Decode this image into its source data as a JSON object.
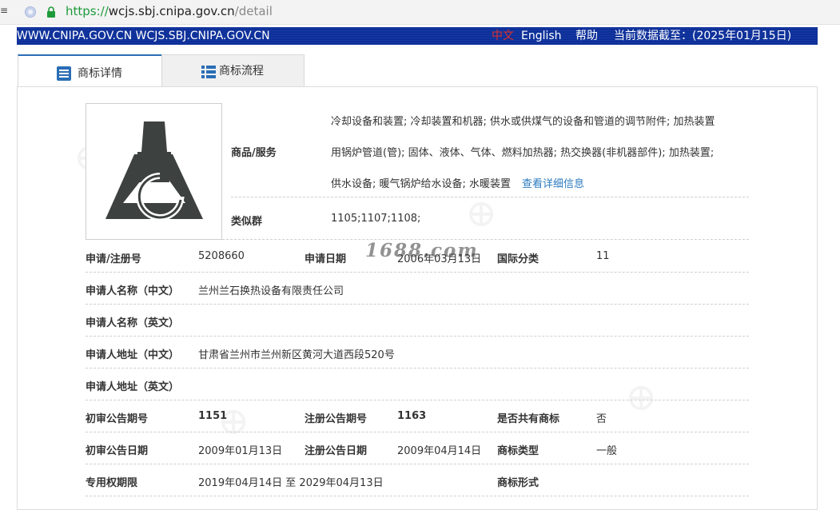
{
  "browser": {
    "url_scheme": "https://",
    "url_host": "wcjs.sbj.cnipa.gov.cn",
    "url_path": "/detail"
  },
  "site_header": {
    "domains": "WWW.CNIPA.GOV.CN  WCJS.SBJ.CNIPA.GOV.CN",
    "lang_zh": "中文",
    "lang_en": "English",
    "help": "帮助",
    "data_date": "当前数据截至：(2025年01月15日)"
  },
  "tabs": [
    {
      "label": "商标详情"
    },
    {
      "label": "商标流程"
    }
  ],
  "watermark_text": "1688.com",
  "detail": {
    "goods_label": "商品/服务",
    "goods_lines": [
      "冷却设备和装置; 冷却装置和机器; 供水或供煤气的设备和管道的调节附件; 加热装置",
      "用锅炉管道(管); 固体、液体、气体、燃料加热器; 热交换器(非机器部件); 加热装置;",
      "供水设备; 暖气锅炉给水设备; 水暖装置"
    ],
    "goods_more_link": "查看详细信息",
    "similar_group_label": "类似群",
    "similar_group_value": "1105;1107;1108;",
    "reg_no_label": "申请/注册号",
    "reg_no_value": "5208660",
    "app_date_label": "申请日期",
    "app_date_value": "2006年03月13日",
    "intl_class_label": "国际分类",
    "intl_class_value": "11",
    "applicant_cn_label": "申请人名称（中文）",
    "applicant_cn_value": "兰州兰石换热设备有限责任公司",
    "applicant_en_label": "申请人名称（英文）",
    "applicant_en_value": "",
    "address_cn_label": "申请人地址（中文）",
    "address_cn_value": "甘肃省兰州市兰州新区黄河大道西段520号",
    "address_en_label": "申请人地址（英文）",
    "address_en_value": "",
    "prelim_issue_label": "初审公告期号",
    "prelim_issue_value": "1151",
    "reg_issue_label": "注册公告期号",
    "reg_issue_value": "1163",
    "shared_label": "是否共有商标",
    "shared_value": "否",
    "prelim_date_label": "初审公告日期",
    "prelim_date_value": "2009年01月13日",
    "reg_date_label": "注册公告日期",
    "reg_date_value": "2009年04月14日",
    "mark_type_label": "商标类型",
    "mark_type_value": "一般",
    "term_label": "专用权期限",
    "term_value": "2019年04月14日 至 2029年04月13日",
    "mark_form_label": "商标形式",
    "mark_form_value": ""
  }
}
